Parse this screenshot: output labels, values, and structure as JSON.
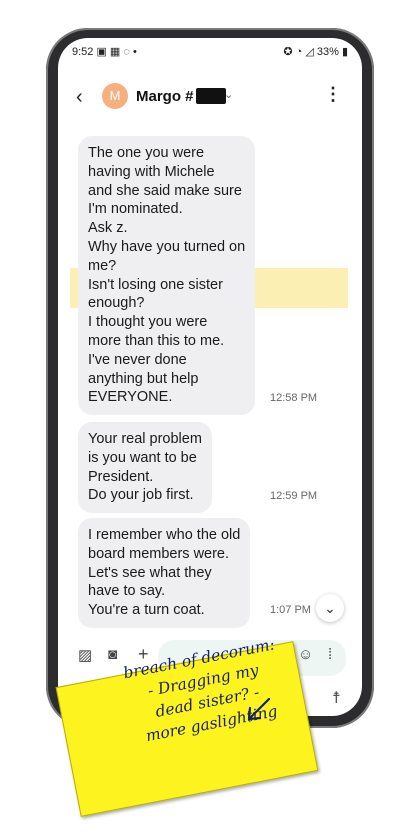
{
  "status_bar": {
    "time": "9:52",
    "left_icons": "▣ ▦ ◌ •",
    "battery": "33%",
    "right_icons": "✪ ◔ ◿"
  },
  "header": {
    "back": "‹",
    "avatar_letter": "M",
    "contact_name": "Margo #",
    "chevron": "⌄",
    "more": "⋮"
  },
  "messages": [
    {
      "lines": [
        "The one you were",
        "having with Michele",
        "and she said make sure",
        "I'm nominated.",
        "Ask z.",
        "Why have you turned on",
        "me?",
        "Isn't losing one sister",
        "enough?",
        "I thought you were",
        "more than this to me.",
        "I've never done",
        "anything but help",
        "EVERYONE."
      ],
      "time": "12:58 PM"
    },
    {
      "lines": [
        "Your real problem",
        "is you want to be",
        "President.",
        "Do your job first."
      ],
      "time": "12:59 PM"
    },
    {
      "lines": [
        "I remember who the old",
        "board members were.",
        "Let's see what they",
        "have to say.",
        "You're a turn coat."
      ],
      "time": "1:07 PM"
    }
  ],
  "compose": {
    "gallery_icon": "gallery-icon",
    "camera_icon": "camera-icon",
    "add_icon": "+",
    "emoji_icon": "☺",
    "voice_icon": "voice-icon"
  },
  "nav": {
    "back": "‹",
    "accessibility": "accessibility-icon"
  },
  "sticky_note": {
    "lines": [
      "breach of decorum:",
      "- Dragging my",
      "dead sister? -",
      "more gaslighting"
    ]
  },
  "colors": {
    "highlight": "#fbe99a",
    "sticky": "#fdf41f",
    "avatar": "#f6b080",
    "bubble": "#efeff1"
  }
}
